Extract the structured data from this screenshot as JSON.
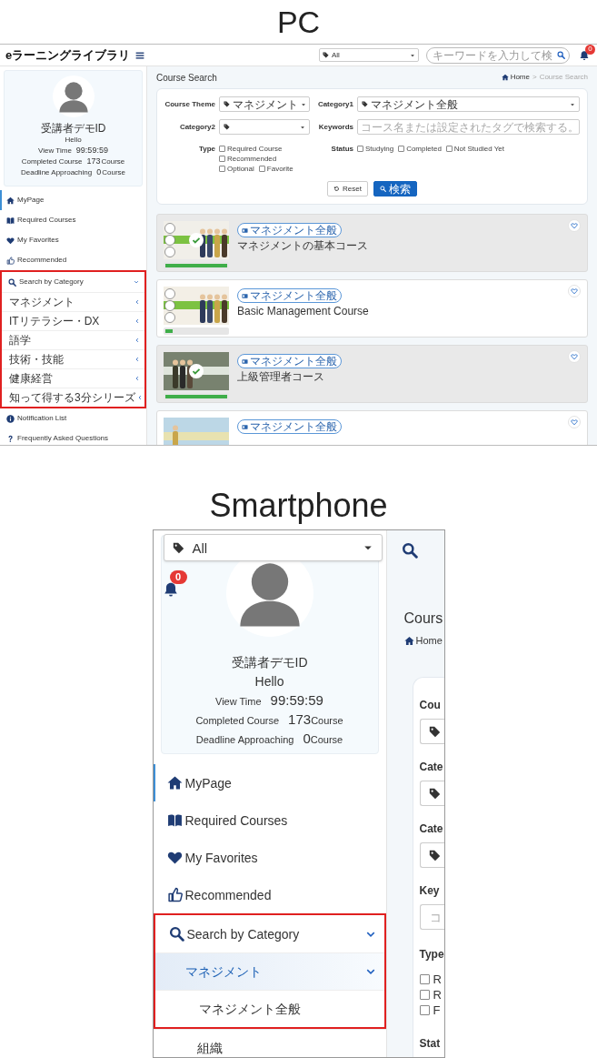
{
  "pc": {
    "caption": "PC",
    "header": {
      "logo": "eラーニングライブラリ",
      "filter": {
        "value": "All"
      },
      "search": {
        "placeholder": "キーワードを入力して検"
      },
      "notifications": {
        "count": "0"
      }
    },
    "profile": {
      "name": "受講者デモID",
      "greeting": "Hello",
      "stats": [
        {
          "label": "View Time",
          "value": "99:59:59"
        },
        {
          "label": "Completed Course",
          "value": "173",
          "unit": "Course"
        },
        {
          "label": "Deadline Approaching",
          "value": "0",
          "unit": "Course"
        }
      ]
    },
    "nav": [
      {
        "kind": "home",
        "label": "MyPage",
        "selected": true,
        "highlighted": false
      },
      {
        "kind": "book",
        "label": "Required Courses",
        "selected": false,
        "highlighted": false
      },
      {
        "kind": "heart",
        "label": "My Favorites",
        "selected": false,
        "highlighted": false
      },
      {
        "kind": "thumb",
        "label": "Recommended",
        "selected": false,
        "highlighted": false
      },
      {
        "kind": "search",
        "label": "Search by Category",
        "selected": false,
        "expanded": true,
        "highlighted": true,
        "children": [
          {
            "label": "マネジメント",
            "selected": false,
            "expanded": false,
            "highlighted": true
          },
          {
            "label": "ITリテラシー・DX",
            "selected": false,
            "expanded": false,
            "highlighted": true
          },
          {
            "label": "語学",
            "selected": false,
            "expanded": false,
            "highlighted": true
          },
          {
            "label": "技術・技能",
            "selected": false,
            "expanded": false,
            "highlighted": true
          },
          {
            "label": "健康経営",
            "selected": false,
            "expanded": false,
            "highlighted": true
          },
          {
            "label": "知って得する3分シリーズ",
            "selected": false,
            "expanded": false,
            "highlighted": true
          }
        ]
      },
      {
        "kind": "info",
        "label": "Notification List",
        "selected": false,
        "highlighted": false
      },
      {
        "kind": "question",
        "label": "Frequently Asked Questions",
        "selected": false,
        "highlighted": false
      }
    ],
    "main": {
      "title": "Course Search",
      "breadcrumb": {
        "items": [
          {
            "kind": "home",
            "label": "Home"
          },
          {
            "label": "Course Search"
          }
        ],
        "separator": ">"
      },
      "form": {
        "fields": [
          {
            "kind": "select",
            "label": "Course Theme",
            "value": "マネジメント"
          },
          {
            "kind": "select",
            "label": "Category1",
            "value": "マネジメント全般"
          },
          {
            "kind": "select",
            "label": "Category2"
          },
          {
            "kind": "text",
            "label": "Keywords",
            "placeholder": "コース名または設定されたタグで検索する。"
          }
        ],
        "groups": [
          {
            "label": "Type",
            "options": [
              {
                "label": "Required Course",
                "checked": false
              },
              {
                "label": "Recommended",
                "checked": false
              },
              {
                "label": "Optional",
                "checked": false
              },
              {
                "label": "Favorite",
                "checked": false
              }
            ]
          },
          {
            "label": "Status",
            "options": [
              {
                "label": "Studying",
                "checked": false
              },
              {
                "label": "Completed",
                "checked": false
              },
              {
                "label": "Not Studied Yet",
                "checked": false
              }
            ]
          }
        ],
        "buttons": [
          {
            "kind": "reset",
            "label": "Reset"
          },
          {
            "kind": "search",
            "label": "検索"
          }
        ]
      },
      "courses": [
        {
          "tag": "マネジメント全般",
          "title": "マネジメントの基本コース",
          "completed": true,
          "level": 1,
          "favorite": false
        },
        {
          "tag": "マネジメント全般",
          "title": "Basic Management Course",
          "completed": false,
          "level": 0.12,
          "favorite": false
        },
        {
          "tag": "マネジメント全般",
          "title": "上級管理者コース",
          "completed": true,
          "level": 1,
          "favorite": false
        },
        {
          "tag": "マネジメント全般",
          "completed": false,
          "favorite": false
        }
      ]
    }
  },
  "smartphone": {
    "caption": "Smartphone",
    "filter": {
      "value": "All"
    },
    "notifications": {
      "count": "0"
    },
    "profile": {
      "name": "受講者デモID",
      "greeting": "Hello",
      "stats": [
        {
          "label": "View Time",
          "value": "99:59:59"
        },
        {
          "label": "Completed Course",
          "value": "173",
          "unit": "Course"
        },
        {
          "label": "Deadline Approaching",
          "value": "0",
          "unit": "Course"
        }
      ]
    },
    "nav": [
      {
        "kind": "home",
        "label": "MyPage",
        "selected": true,
        "highlighted": false
      },
      {
        "kind": "book",
        "label": "Required Courses",
        "selected": false,
        "highlighted": false
      },
      {
        "kind": "heart",
        "label": "My Favorites",
        "selected": false,
        "highlighted": false
      },
      {
        "kind": "thumb",
        "label": "Recommended",
        "selected": false,
        "highlighted": false
      },
      {
        "kind": "search",
        "label": "Search by Category",
        "selected": false,
        "expanded": true,
        "highlighted": true,
        "children": [
          {
            "label": "マネジメント",
            "selected": true,
            "expanded": true,
            "highlighted": true,
            "children": [
              {
                "label": "マネジメント全般",
                "selected": false,
                "highlighted": true
              },
              {
                "label": "組織",
                "selected": false,
                "highlighted": false
              }
            ]
          }
        ]
      }
    ],
    "main": {
      "title": "Cours",
      "breadcrumb": {
        "items": [
          {
            "kind": "home",
            "label": "Home"
          }
        ]
      },
      "form": {
        "fields": [
          {
            "kind": "select",
            "label": "Cou"
          },
          {
            "kind": "select",
            "label": "Cate"
          },
          {
            "kind": "select",
            "label": "Cate"
          },
          {
            "kind": "text",
            "label": "Key",
            "placeholder": "コ"
          }
        ],
        "groups": [
          {
            "label": "Type",
            "options": [
              {
                "label": "R",
                "checked": false
              },
              {
                "label": "R",
                "checked": false
              },
              {
                "label": "F",
                "checked": false
              }
            ]
          },
          {
            "label": "Stat"
          }
        ]
      }
    }
  }
}
